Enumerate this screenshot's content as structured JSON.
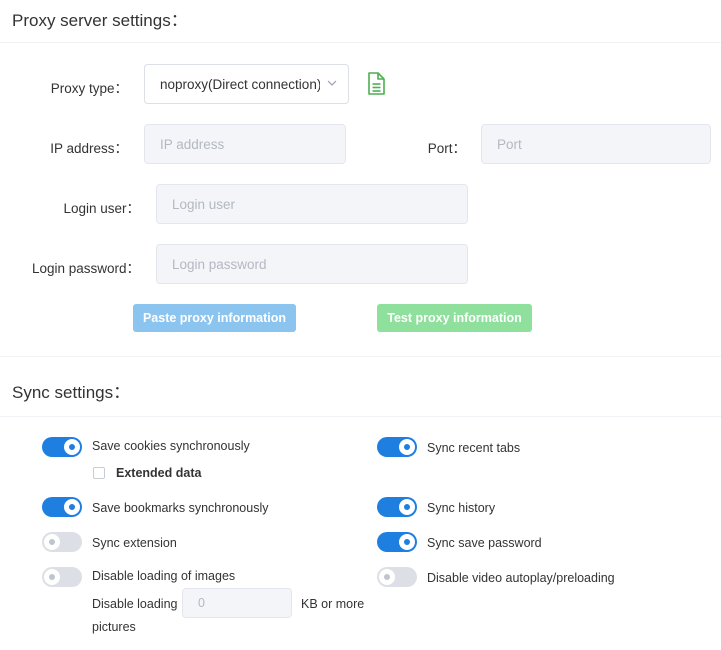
{
  "proxy": {
    "title": "Proxy server settings：",
    "type_label": "Proxy type：",
    "type_value": "noproxy(Direct connection)",
    "ip_label": "IP address：",
    "ip_placeholder": "IP address",
    "port_label": "Port：",
    "port_placeholder": "Port",
    "user_label": "Login user：",
    "user_placeholder": "Login user",
    "password_label": "Login password：",
    "password_placeholder": "Login password",
    "paste_button": "Paste proxy information",
    "test_button": "Test proxy information"
  },
  "sync": {
    "title": "Sync settings：",
    "left": [
      {
        "label": "Save cookies synchronously",
        "on": true
      },
      {
        "label": "Save bookmarks synchronously",
        "on": true
      },
      {
        "label": "Sync extension",
        "on": false
      },
      {
        "label": "Disable loading of images",
        "on": false
      }
    ],
    "right": [
      {
        "label": "Sync recent tabs",
        "on": true
      },
      {
        "label": "Sync history",
        "on": true
      },
      {
        "label": "Sync save password",
        "on": true
      },
      {
        "label": "Disable video autoplay/preloading",
        "on": false
      }
    ],
    "extended_data_label": "Extended data",
    "extended_data_checked": false,
    "disable_pictures_label_1": "Disable loading",
    "disable_pictures_label_2": "pictures",
    "disable_pictures_value": "0",
    "disable_pictures_unit": "KB or more"
  },
  "colors": {
    "toggle_on": "#1e7fe0",
    "toggle_off": "#dcdfe6",
    "paste_button": "#8cc4f0",
    "test_button": "#8fe09c",
    "doc_icon": "#4caf50"
  },
  "icons": {
    "select_arrow": "chevron-down-icon",
    "proxy_doc": "document-icon"
  }
}
